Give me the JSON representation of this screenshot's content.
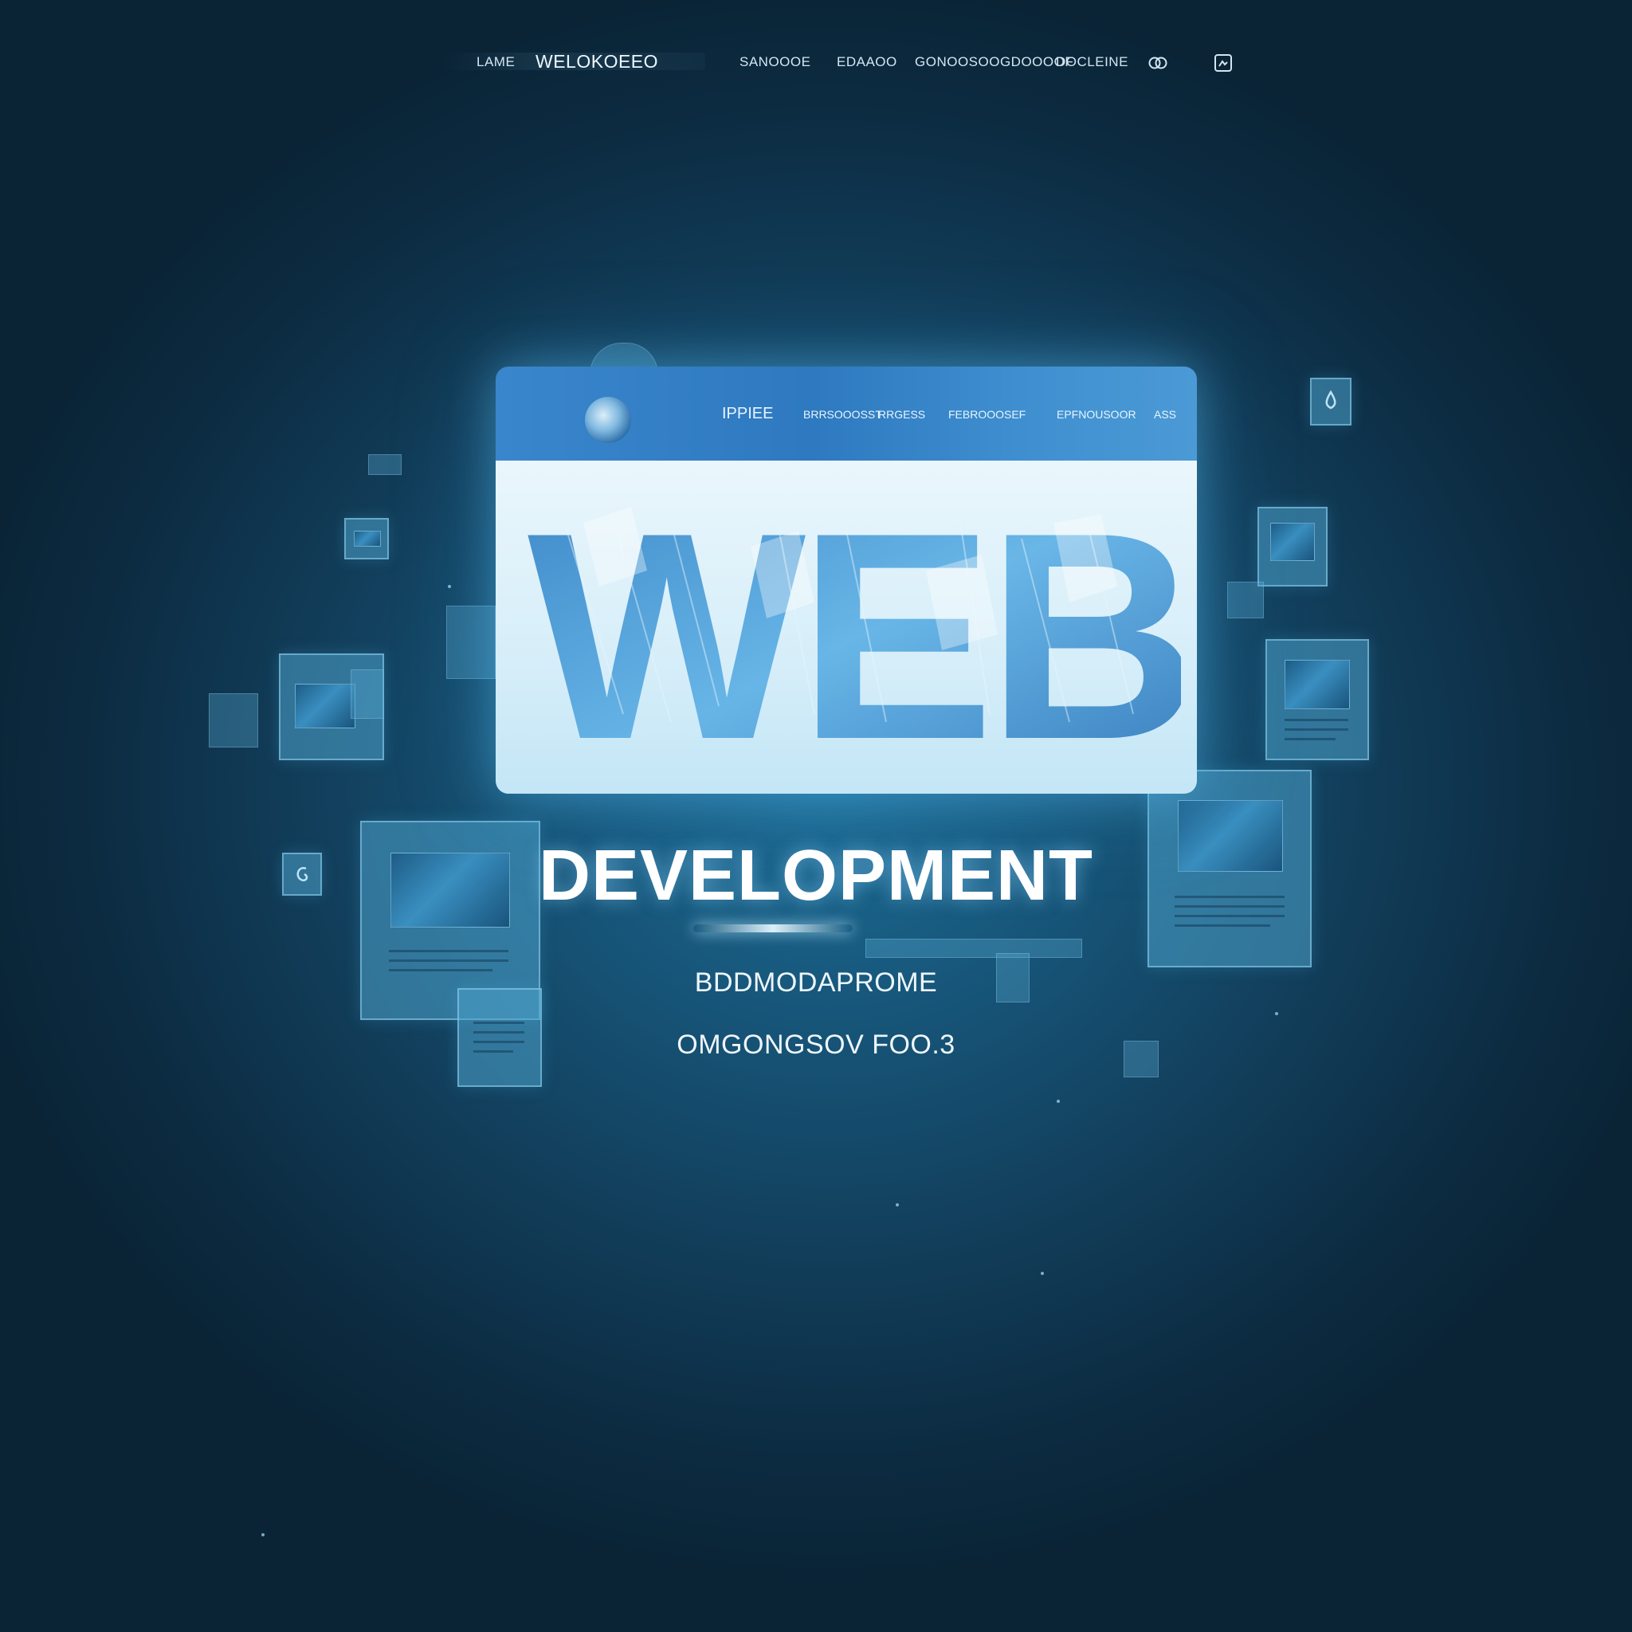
{
  "nav": {
    "item_left": "LAME",
    "brand": "WELOKOEEO",
    "items": [
      "SANOOOE",
      "EDAAOO",
      "GONOOSOOGDOOOOF",
      "DOCLEINE"
    ],
    "icons": [
      "eye-icon",
      "image-icon"
    ]
  },
  "browser": {
    "bar_items": [
      "IPPIEE",
      "BRRSOOOSST",
      "RRGESS",
      "FEBROOOSEF",
      "EPFNOUSOOR",
      "ASS"
    ],
    "art_label": "WEB"
  },
  "hero": {
    "headline": "DEVELOPMENT",
    "subline_1": "BDDMODAPROME",
    "subline_2": "OMGONGSOV FOO.3"
  },
  "colors": {
    "background": "#123f5c",
    "browser_bar": "#3a86cc",
    "browser_body": "#eaf6fc",
    "tile": "#4ca2cc",
    "text": "#ffffff"
  }
}
